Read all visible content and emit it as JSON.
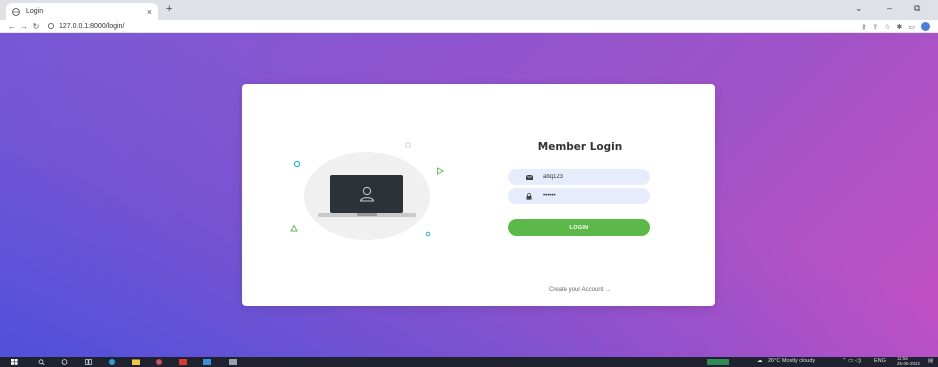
{
  "browser": {
    "tab_title": "Login",
    "tab_close": "×",
    "new_tab": "+",
    "window_controls": [
      "⌄",
      "–",
      "⧉"
    ],
    "url": "127.0.0.1:8000/login/",
    "icons": [
      "key-icon",
      "share-icon",
      "star-icon",
      "extensions-icon",
      "sidebar-icon",
      "profile-avatar"
    ]
  },
  "login": {
    "title": "Member Login",
    "username_value": "abq123",
    "password_value": "••••••",
    "button_label": "LOGIN",
    "create_account": "Create your Account →"
  },
  "taskbar": {
    "weather": "26°C  Mostly cloudy",
    "language": "ENG",
    "time": "11:56",
    "date": "25-06-2022"
  },
  "colors": {
    "accent_green": "#5cb949",
    "input_bg": "#e6ecfb",
    "gradient_start": "#4c5ad9",
    "gradient_end": "#c650c4"
  }
}
